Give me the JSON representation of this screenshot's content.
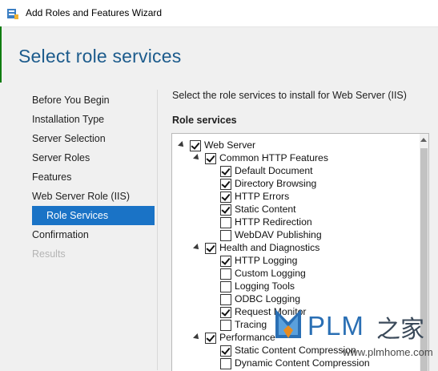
{
  "window": {
    "title": "Add Roles and Features Wizard"
  },
  "page": {
    "title": "Select role services"
  },
  "nav": {
    "items": [
      {
        "label": "Before You Begin",
        "state": "normal"
      },
      {
        "label": "Installation Type",
        "state": "normal"
      },
      {
        "label": "Server Selection",
        "state": "normal"
      },
      {
        "label": "Server Roles",
        "state": "normal"
      },
      {
        "label": "Features",
        "state": "normal"
      },
      {
        "label": "Web Server Role (IIS)",
        "state": "normal"
      },
      {
        "label": "Role Services",
        "state": "selected"
      },
      {
        "label": "Confirmation",
        "state": "normal"
      },
      {
        "label": "Results",
        "state": "disabled"
      }
    ]
  },
  "content": {
    "instruction": "Select the role services to install for Web Server (IIS)",
    "section_label": "Role services"
  },
  "tree": [
    {
      "label": "Web Server",
      "checked": true,
      "expanded": true,
      "level": 0
    },
    {
      "label": "Common HTTP Features",
      "checked": true,
      "expanded": true,
      "level": 1
    },
    {
      "label": "Default Document",
      "checked": true,
      "level": 2
    },
    {
      "label": "Directory Browsing",
      "checked": true,
      "level": 2
    },
    {
      "label": "HTTP Errors",
      "checked": true,
      "level": 2
    },
    {
      "label": "Static Content",
      "checked": true,
      "level": 2
    },
    {
      "label": "HTTP Redirection",
      "checked": false,
      "level": 2
    },
    {
      "label": "WebDAV Publishing",
      "checked": false,
      "level": 2
    },
    {
      "label": "Health and Diagnostics",
      "checked": true,
      "expanded": true,
      "level": 1
    },
    {
      "label": "HTTP Logging",
      "checked": true,
      "level": 2
    },
    {
      "label": "Custom Logging",
      "checked": false,
      "level": 2
    },
    {
      "label": "Logging Tools",
      "checked": false,
      "level": 2
    },
    {
      "label": "ODBC Logging",
      "checked": false,
      "level": 2
    },
    {
      "label": "Request Monitor",
      "checked": true,
      "level": 2
    },
    {
      "label": "Tracing",
      "checked": false,
      "level": 2
    },
    {
      "label": "Performance",
      "checked": true,
      "expanded": true,
      "level": 1
    },
    {
      "label": "Static Content Compression",
      "checked": true,
      "level": 2
    },
    {
      "label": "Dynamic Content Compression",
      "checked": false,
      "level": 2
    }
  ],
  "watermark": {
    "brand": "PLM",
    "cn": "之家",
    "url": "www.plmhome.com"
  },
  "colors": {
    "accent": "#1a73c6",
    "title": "#1c5b8c"
  }
}
